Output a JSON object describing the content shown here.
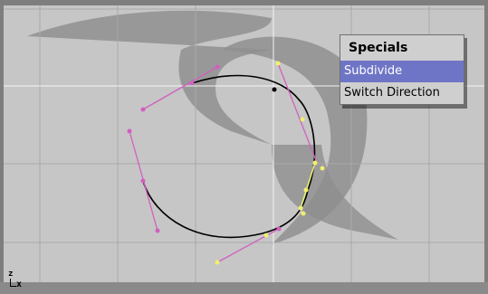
{
  "popup": {
    "title": "Specials",
    "items": [
      {
        "label": "Subdivide",
        "selected": true
      },
      {
        "label": "Switch Direction",
        "selected": false
      }
    ]
  },
  "axis_widget": {
    "up_axis": "z",
    "right_axis": "x"
  },
  "colors": {
    "background": "#c6c6c6",
    "grid": "#a8a8a8",
    "shadow_shape": "#8f8f8f",
    "curve": "#000000",
    "handle_unselected": "#d060c0",
    "handle_selected": "#f0f070",
    "cursor_line": "#ffffff",
    "menu_highlight": "#6f75c6"
  }
}
